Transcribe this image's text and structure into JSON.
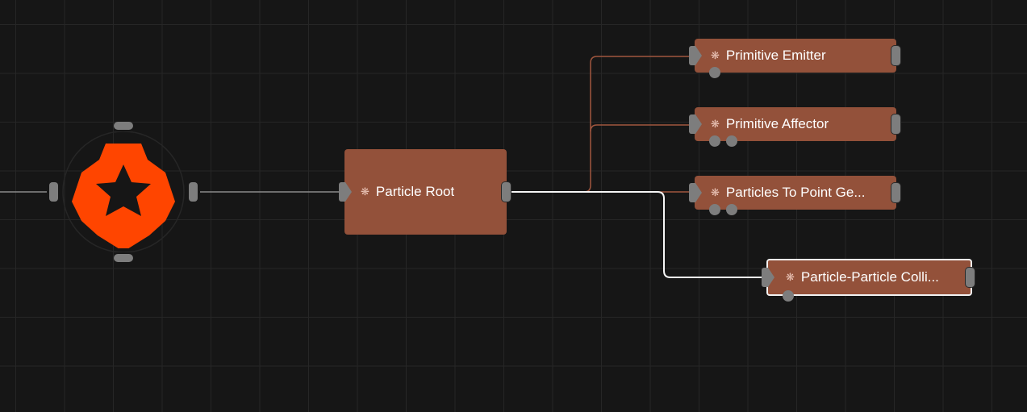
{
  "graph": {
    "root_icon": "logo-gear-icon",
    "accent_color": "#ff4500",
    "node_color": "#93513a",
    "nodes": [
      {
        "id": "particle-root",
        "title": "Particle Root",
        "icon": "gear-icon"
      },
      {
        "id": "primitive-emitter",
        "title": "Primitive Emitter",
        "icon": "gear-icon"
      },
      {
        "id": "primitive-affector",
        "title": "Primitive Affector",
        "icon": "gear-icon"
      },
      {
        "id": "particles-to-point",
        "title": "Particles To Point Ge...",
        "icon": "gear-icon"
      },
      {
        "id": "particle-collision",
        "title": "Particle-Particle Colli...",
        "icon": "gear-icon",
        "selected": true
      }
    ]
  }
}
